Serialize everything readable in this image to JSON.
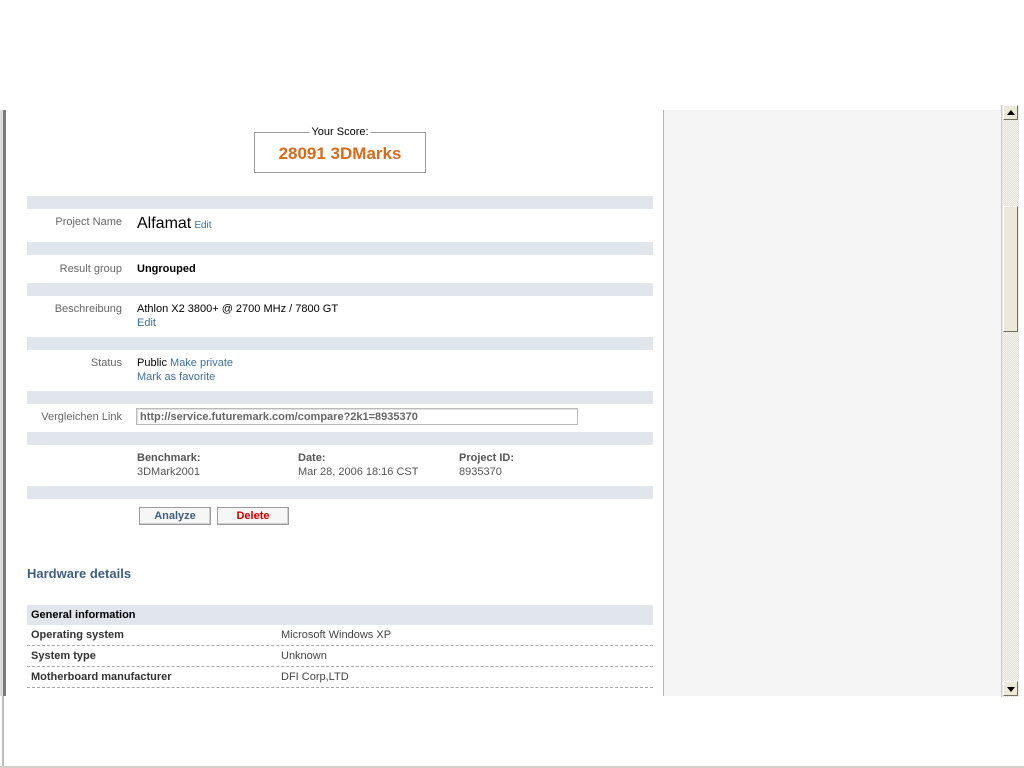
{
  "score": {
    "legend": "Your Score:",
    "value": "28091 3DMarks"
  },
  "project": {
    "label": "Project Name",
    "name": "Alfamat",
    "edit": "Edit"
  },
  "result_group": {
    "label": "Result group",
    "value": "Ungrouped"
  },
  "description": {
    "label": "Beschreibung",
    "value": "Athlon X2 3800+ @ 2700 MHz / 7800 GT",
    "edit": "Edit"
  },
  "status": {
    "label": "Status",
    "value": "Public",
    "make_private": "Make private",
    "favorite": "Mark as favorite"
  },
  "compare": {
    "label": "Vergleichen Link",
    "url": "http://service.futuremark.com/compare?2k1=8935370"
  },
  "meta": {
    "benchmark_label": "Benchmark:",
    "benchmark": "3DMark2001",
    "date_label": "Date:",
    "date": "Mar 28, 2006 18:16 CST",
    "project_id_label": "Project ID:",
    "project_id": "8935370"
  },
  "buttons": {
    "analyze": "Analyze",
    "delete": "Delete"
  },
  "hardware": {
    "title": "Hardware details",
    "section": "General information",
    "rows": [
      {
        "key": "Operating system",
        "value": "Microsoft Windows XP"
      },
      {
        "key": "System type",
        "value": "Unknown"
      },
      {
        "key": "Motherboard manufacturer",
        "value": "DFI Corp,LTD"
      }
    ]
  },
  "colors": {
    "score": "#d86b1a",
    "link": "#3f6f9b",
    "band": "#e1e6ec",
    "delete": "#cc0000"
  }
}
